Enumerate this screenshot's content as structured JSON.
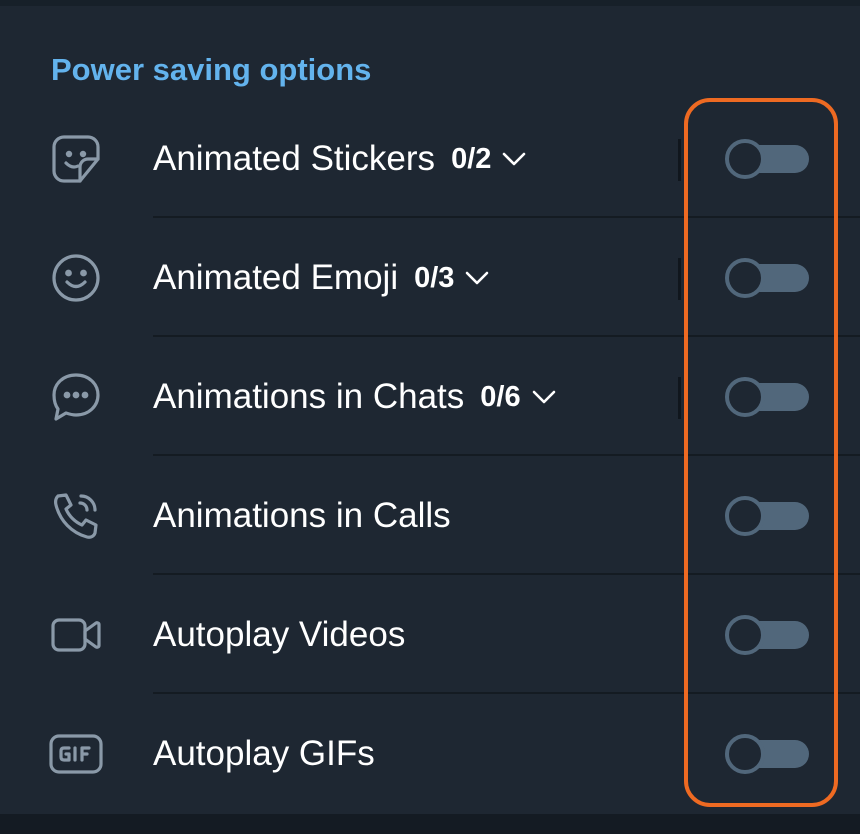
{
  "section": {
    "title": "Power saving options"
  },
  "rows": [
    {
      "label": "Animated Stickers",
      "count": "0/2",
      "icon": "sticker-icon",
      "expandable": true,
      "enabled": false
    },
    {
      "label": "Animated Emoji",
      "count": "0/3",
      "icon": "smiley-icon",
      "expandable": true,
      "enabled": false
    },
    {
      "label": "Animations in Chats",
      "count": "0/6",
      "icon": "chat-bubble-icon",
      "expandable": true,
      "enabled": false
    },
    {
      "label": "Animations in Calls",
      "icon": "phone-icon",
      "expandable": false,
      "enabled": false
    },
    {
      "label": "Autoplay Videos",
      "icon": "video-camera-icon",
      "expandable": false,
      "enabled": false
    },
    {
      "label": "Autoplay GIFs",
      "icon": "gif-icon",
      "expandable": false,
      "enabled": false
    }
  ],
  "colors": {
    "background": "#1e2732",
    "accent": "#63b3ed",
    "toggle_off": "#51677b",
    "highlight": "#ee6a22"
  }
}
